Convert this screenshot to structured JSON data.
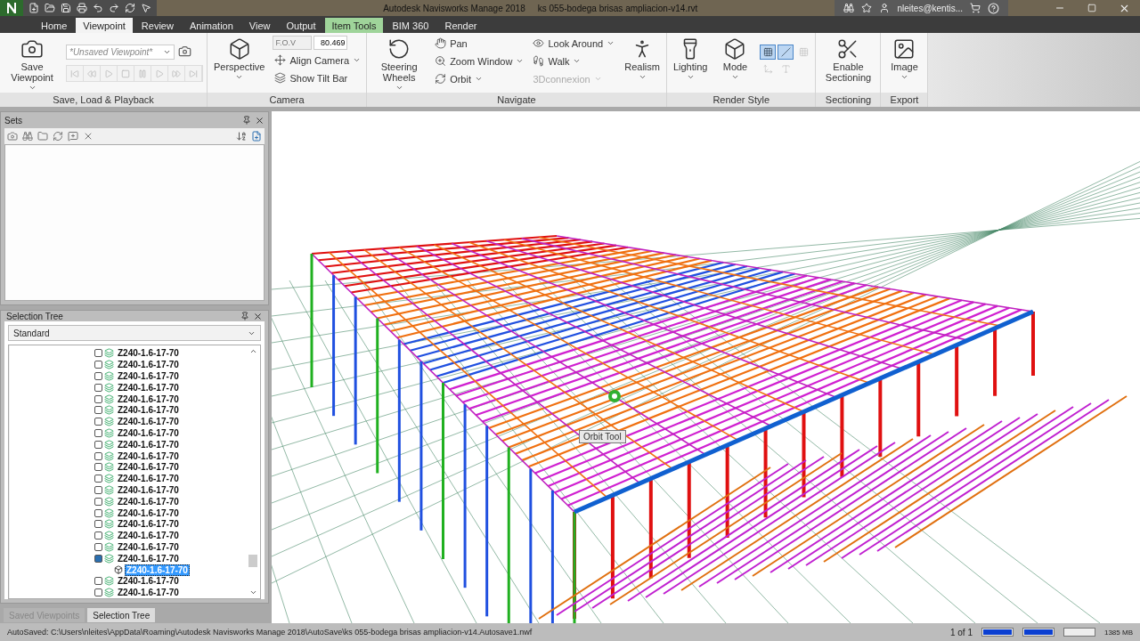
{
  "window": {
    "app_name": "Autodesk Navisworks Manage 2018",
    "file_name": "ks 055-bodega brisas ampliacion-v14.rvt",
    "user": "nleites@kentis..."
  },
  "tabs": [
    {
      "label": "Home",
      "selected": false,
      "contextual": false
    },
    {
      "label": "Viewpoint",
      "selected": true,
      "contextual": false
    },
    {
      "label": "Review",
      "selected": false,
      "contextual": false
    },
    {
      "label": "Animation",
      "selected": false,
      "contextual": false
    },
    {
      "label": "View",
      "selected": false,
      "contextual": false
    },
    {
      "label": "Output",
      "selected": false,
      "contextual": false
    },
    {
      "label": "Item Tools",
      "selected": false,
      "contextual": true
    },
    {
      "label": "BIM 360",
      "selected": false,
      "contextual": false
    },
    {
      "label": "Render",
      "selected": false,
      "contextual": false
    }
  ],
  "ribbon": [
    {
      "label": "Save, Load & Playback",
      "items": [
        {
          "kind": "large",
          "label": "Save Viewpoint",
          "dropdown": true
        },
        {
          "kind": "viewpoint",
          "placeholder": "*Unsaved Viewpoint*"
        }
      ]
    },
    {
      "label": "Camera",
      "items": [
        {
          "kind": "large",
          "label": "Perspective",
          "dropdown": true
        },
        {
          "kind": "stack",
          "items": [
            {
              "kind": "fov",
              "placeholder": "F.O.V",
              "value": "80.469"
            },
            {
              "kind": "small",
              "label": "Align Camera",
              "dropdown": true,
              "disabled": false
            },
            {
              "kind": "small",
              "label": "Show Tilt Bar",
              "dropdown": false,
              "disabled": false
            }
          ]
        }
      ]
    },
    {
      "label": "Navigate",
      "items": [
        {
          "kind": "large",
          "label": "Steering Wheels",
          "dropdown": true
        },
        {
          "kind": "stack",
          "items": [
            {
              "kind": "small",
              "label": "Pan",
              "dropdown": false,
              "disabled": false
            },
            {
              "kind": "small",
              "label": "Zoom Window",
              "dropdown": true,
              "disabled": false
            },
            {
              "kind": "small",
              "label": "Orbit",
              "dropdown": true,
              "disabled": false
            }
          ]
        },
        {
          "kind": "stack",
          "items": [
            {
              "kind": "small",
              "label": "Look Around",
              "dropdown": true,
              "disabled": false
            },
            {
              "kind": "small",
              "label": "Walk",
              "dropdown": true,
              "disabled": false
            },
            {
              "kind": "small",
              "label": "3Dconnexion",
              "dropdown": true,
              "disabled": true
            }
          ]
        },
        {
          "kind": "large",
          "label": "Realism",
          "dropdown": true
        }
      ]
    },
    {
      "label": "Render Style",
      "items": [
        {
          "kind": "large",
          "label": "Lighting",
          "dropdown": true
        },
        {
          "kind": "large",
          "label": "Mode",
          "dropdown": true
        },
        {
          "kind": "toggles",
          "items": [
            {
              "selected": true,
              "disabled": false
            },
            {
              "selected": true,
              "disabled": false
            },
            {
              "selected": false,
              "disabled": true
            },
            {
              "selected": false,
              "disabled": true
            },
            {
              "selected": false,
              "disabled": true
            }
          ]
        }
      ]
    },
    {
      "label": "Sectioning",
      "items": [
        {
          "kind": "large",
          "label": "Enable Sectioning",
          "dropdown": false
        }
      ]
    },
    {
      "label": "Export",
      "items": [
        {
          "kind": "large",
          "label": "Image",
          "dropdown": true
        }
      ]
    }
  ],
  "sets_panel": {
    "title": "Sets"
  },
  "selection_tree": {
    "title": "Selection Tree",
    "mode": "Standard",
    "items": [
      {
        "label": "Z240-1.6-17-70",
        "expanded": false,
        "selected": false
      },
      {
        "label": "Z240-1.6-17-70",
        "expanded": false,
        "selected": false
      },
      {
        "label": "Z240-1.6-17-70",
        "expanded": false,
        "selected": false
      },
      {
        "label": "Z240-1.6-17-70",
        "expanded": false,
        "selected": false
      },
      {
        "label": "Z240-1.6-17-70",
        "expanded": false,
        "selected": false
      },
      {
        "label": "Z240-1.6-17-70",
        "expanded": false,
        "selected": false
      },
      {
        "label": "Z240-1.6-17-70",
        "expanded": false,
        "selected": false
      },
      {
        "label": "Z240-1.6-17-70",
        "expanded": false,
        "selected": false
      },
      {
        "label": "Z240-1.6-17-70",
        "expanded": false,
        "selected": false
      },
      {
        "label": "Z240-1.6-17-70",
        "expanded": false,
        "selected": false
      },
      {
        "label": "Z240-1.6-17-70",
        "expanded": false,
        "selected": false
      },
      {
        "label": "Z240-1.6-17-70",
        "expanded": false,
        "selected": false
      },
      {
        "label": "Z240-1.6-17-70",
        "expanded": false,
        "selected": false
      },
      {
        "label": "Z240-1.6-17-70",
        "expanded": false,
        "selected": false
      },
      {
        "label": "Z240-1.6-17-70",
        "expanded": false,
        "selected": false
      },
      {
        "label": "Z240-1.6-17-70",
        "expanded": false,
        "selected": false
      },
      {
        "label": "Z240-1.6-17-70",
        "expanded": false,
        "selected": false
      },
      {
        "label": "Z240-1.6-17-70",
        "expanded": false,
        "selected": false
      },
      {
        "label": "Z240-1.6-17-70",
        "expanded": true,
        "selected": false,
        "children": [
          {
            "label": "Z240-1.6-17-70",
            "selected": true
          }
        ]
      },
      {
        "label": "Z240-1.6-17-70",
        "expanded": false,
        "selected": false
      },
      {
        "label": "Z240-1.6-17-70",
        "expanded": false,
        "selected": false
      }
    ]
  },
  "panel_tabs": [
    {
      "label": "Saved Viewpoints",
      "selected": false
    },
    {
      "label": "Selection Tree",
      "selected": true
    }
  ],
  "viewport": {
    "tooltip": "Orbit Tool"
  },
  "status_bar": {
    "message": "AutoSaved: C:\\Users\\nleites\\AppData\\Roaming\\Autodesk Navisworks Manage 2018\\AutoSave\\ks 055-bodega brisas ampliacion-v14.Autosave1.nwf",
    "page": "1 of 1",
    "meters": [
      {
        "level": 1
      },
      {
        "level": 1
      },
      {
        "level": 0
      }
    ],
    "memory": "1385 MB"
  }
}
